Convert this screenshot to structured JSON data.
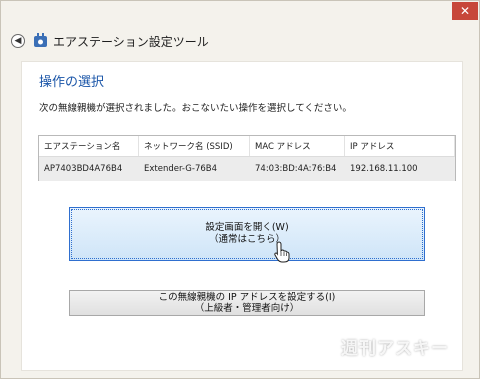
{
  "window": {
    "title": "エアステーション設定ツール",
    "close_glyph": "✕",
    "back_glyph": "◀"
  },
  "page": {
    "heading": "操作の選択",
    "instruction": "次の無線親機が選択されました。おこないたい操作を選択してください。"
  },
  "device_list": {
    "columns": [
      "エアステーション名",
      "ネットワーク名 (SSID)",
      "MAC アドレス",
      "IP アドレス"
    ],
    "rows": [
      [
        "AP7403BD4A76B4",
        "Extender-G-76B4",
        "74:03:BD:4A:76:B4",
        "192.168.11.100"
      ]
    ]
  },
  "actions": {
    "open_settings": {
      "line1": "設定画面を開く(W)",
      "line2": "（通常はこちら）"
    },
    "set_ip": {
      "line1": "この無線親機の IP アドレスを設定する(I)",
      "line2": "（上級者・管理者向け）"
    }
  },
  "watermark": "週刊アスキー",
  "colors": {
    "accent_blue": "#1a55a8",
    "close_red": "#c7473a",
    "primary_btn_border": "#2f6fcf"
  }
}
